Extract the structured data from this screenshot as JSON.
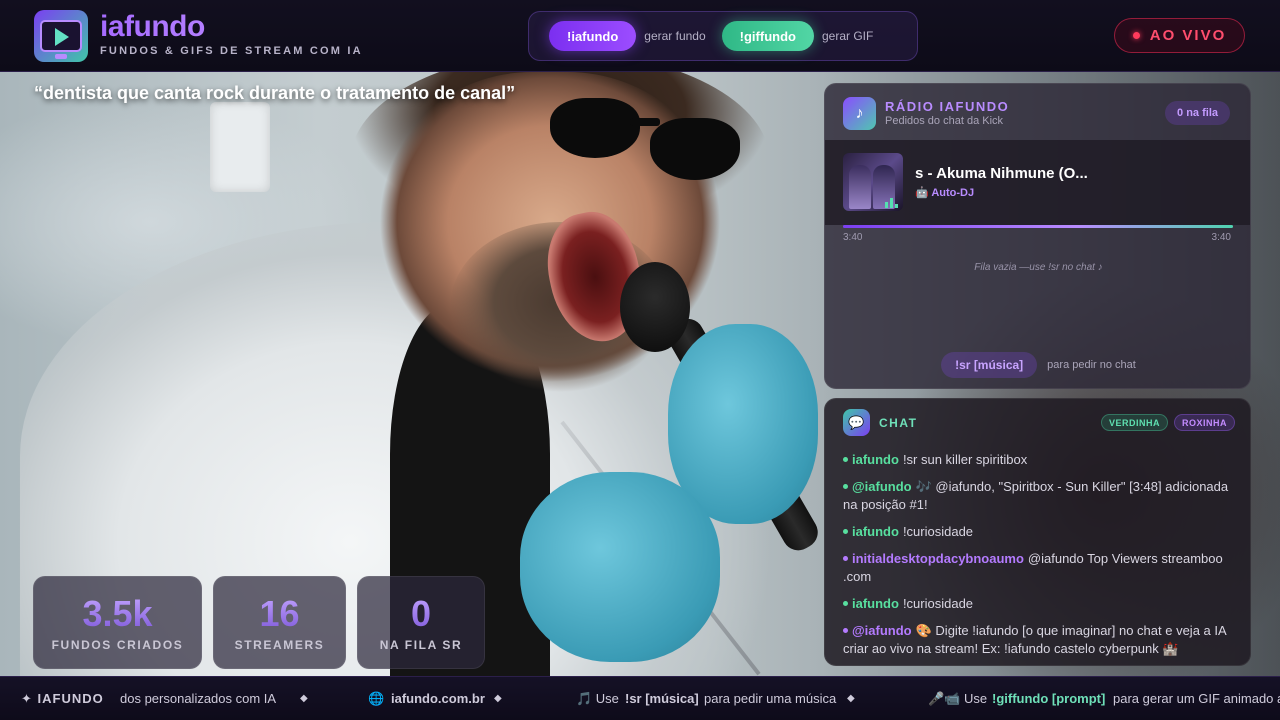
{
  "header": {
    "brand_name": "iafundo",
    "brand_subtitle": "FUNDOS & GIFS DE STREAM COM IA",
    "commands": [
      {
        "label": "!iafundo",
        "description": "gerar fundo",
        "color": "#8a3ff7"
      },
      {
        "label": "!giffundo",
        "description": "gerar GIF",
        "color": "#3fc796"
      }
    ],
    "live_label": "AO VIVO"
  },
  "prompt": "“dentista que canta rock durante o tratamento de canal”",
  "stats": [
    {
      "value": "3.5k",
      "label": "FUNDOS CRIADOS"
    },
    {
      "value": "16",
      "label": "STREAMERS"
    },
    {
      "value": "0",
      "label": "NA FILA SR"
    }
  ],
  "radio": {
    "title": "RÁDIO IAFUNDO",
    "subtitle": "Pedidos do chat da Kick",
    "queue_badge": "0 na fila",
    "now_playing": {
      "title": "s - Akuma Nihmune (O...",
      "source": "🤖 Auto-DJ",
      "elapsed": "3:40",
      "duration": "3:40",
      "progress_fraction": 1.0
    },
    "empty_queue_text": "Fila vazia —use !sr no chat ♪",
    "request_command": "!sr [música]",
    "request_hint": "para pedir no chat"
  },
  "chat": {
    "title": "CHAT",
    "tags": [
      "VERDINHA",
      "ROXINHA"
    ],
    "messages": [
      {
        "user": "iafundo",
        "color": "green",
        "text": "!sr sun killer spiritibox"
      },
      {
        "user": "@iafundo",
        "color": "green",
        "text": "🎶 @iafundo, \"Spiritbox - Sun Killer\" [3:48] adicionada na posição #1!"
      },
      {
        "user": "iafundo",
        "color": "green",
        "text": "!curiosidade"
      },
      {
        "user": "initialdesktopdacybnoaumo",
        "color": "purple",
        "text": "@iafundo Top Viewers streamboo .com"
      },
      {
        "user": "iafundo",
        "color": "green",
        "text": "!curiosidade"
      },
      {
        "user": "@iafundo",
        "color": "purple",
        "text": "🎨 Digite !iafundo [o que imaginar] no chat e veja a IA criar ao vivo na stream! Ex: !iafundo castelo cyberpunk 🏰"
      }
    ]
  },
  "ticker": {
    "brand": "✦ IAFUNDO",
    "separator": "◆",
    "item1": "dos personalizados com IA",
    "url_icon": "🌐",
    "url": "iafundo.com.br",
    "item3_prefix": "🎵 Use",
    "item3_cmd": "!sr [música]",
    "item3_suffix": "para pedir uma música",
    "item4_prefix": "🎤📹 Use",
    "item4_cmd": "!giffundo [prompt]",
    "item4_suffix": "para gerar um GIF animado a"
  },
  "icons": {
    "logo": "screen-play-icon",
    "radio": "music-note-icon",
    "chat": "speech-bubble-icon",
    "live": "live-dot-icon"
  },
  "colors": {
    "accent_purple": "#9c4dff",
    "accent_green": "#52d6a5",
    "live_red": "#ff4d6d"
  }
}
